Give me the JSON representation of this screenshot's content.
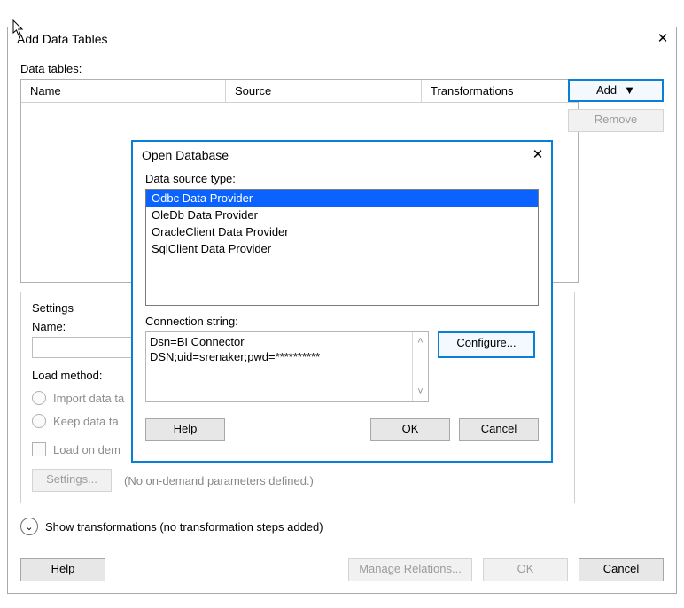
{
  "main": {
    "title": "Add Data Tables",
    "data_tables_label": "Data tables:",
    "col1": "Name",
    "col2": "Source",
    "col3": "Transformations",
    "add_btn": "Add",
    "remove_btn": "Remove",
    "settings_title": "Settings",
    "name_label": "Name:",
    "name_value": "",
    "load_label": "Load method:",
    "radio_import": "Import data ta",
    "radio_keep": "Keep data ta",
    "chk_ondemand": "Load on dem",
    "settings_btn": "Settings...",
    "ondemand_note": "(No on-demand parameters defined.)",
    "expander": "Show transformations (no transformation steps added)",
    "help_btn": "Help",
    "manage_btn": "Manage Relations...",
    "ok_btn": "OK",
    "cancel_btn": "Cancel"
  },
  "modal": {
    "title": "Open Database",
    "dstype_label": "Data source type:",
    "items": [
      "Odbc Data Provider",
      "OleDb Data Provider",
      "OracleClient Data Provider",
      "SqlClient Data Provider"
    ],
    "cs_label": "Connection string:",
    "cs_line1": "Dsn=BI Connector",
    "cs_line2": "DSN;uid=srenaker;pwd=**********",
    "configure_btn": "Configure...",
    "help_btn": "Help",
    "ok_btn": "OK",
    "cancel_btn": "Cancel"
  }
}
